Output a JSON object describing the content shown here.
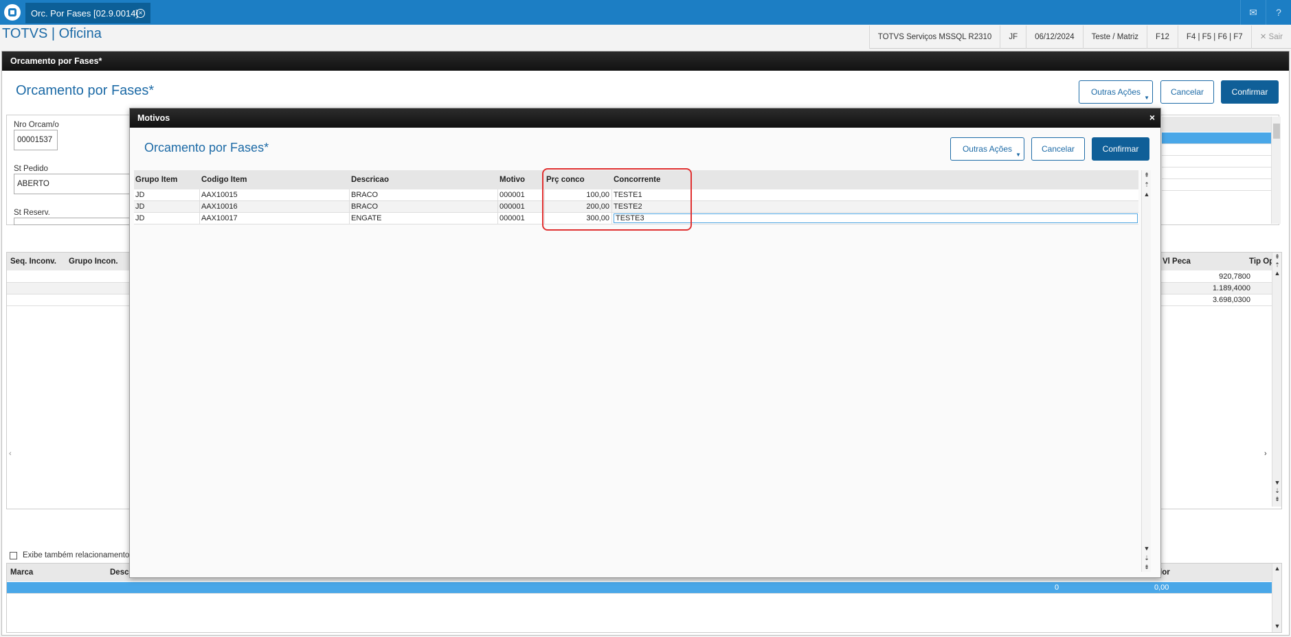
{
  "topbar": {
    "tab_label": "Orc. Por Fases [02.9.0014]",
    "tab_close": "×"
  },
  "header": {
    "app_title": "TOTVS | Oficina",
    "status": [
      "TOTVS Serviços MSSQL R2310",
      "JF",
      "06/12/2024",
      "Teste / Matriz",
      "F12",
      "F4 | F5 | F6 | F7"
    ],
    "exit_label": "Sair"
  },
  "main": {
    "window_title": "Orcamento por Fases*",
    "subtitle": "Orcamento por Fases*",
    "buttons": {
      "other": "Outras Ações",
      "cancel": "Cancelar",
      "confirm": "Confirmar"
    },
    "fields": {
      "nro_label": "Nro Orcam/o",
      "nro_value": "00001537",
      "stpedido_label": "St Pedido",
      "stpedido_value": "ABERTO",
      "streserv_label": "St Reserv."
    },
    "grid2": {
      "headers": [
        "Seq. Inconv.",
        "Grupo Incon.",
        "Vl Peca",
        "Tip Op"
      ],
      "values": [
        "920,7800",
        "1.189,4000",
        "3.698,0300"
      ]
    },
    "checkbox_label": "Exibe também relacionamentos",
    "grid3": {
      "headers": [
        "Marca",
        "Descri",
        "lor"
      ],
      "row": [
        "0",
        "0,00"
      ]
    }
  },
  "modal": {
    "title": "Motivos",
    "close": "×",
    "subtitle": "Orcamento por Fases*",
    "buttons": {
      "other": "Outras Ações",
      "cancel": "Cancelar",
      "confirm": "Confirmar"
    },
    "columns": [
      "Grupo Item",
      "Codigo Item",
      "Descricao",
      "Motivo",
      "Prç conco",
      "Concorrente"
    ],
    "rows": [
      [
        "JD",
        "AAX10015",
        "BRACO",
        "000001",
        "100,00",
        "TESTE1"
      ],
      [
        "JD",
        "AAX10016",
        "BRACO",
        "000001",
        "200,00",
        "TESTE2"
      ],
      [
        "JD",
        "AAX10017",
        "ENGATE",
        "000001",
        "300,00",
        "TESTE3"
      ]
    ]
  },
  "colors": {
    "brand": "#1c7ec4",
    "accent": "#0f5f98",
    "highlight": "#e03030"
  }
}
